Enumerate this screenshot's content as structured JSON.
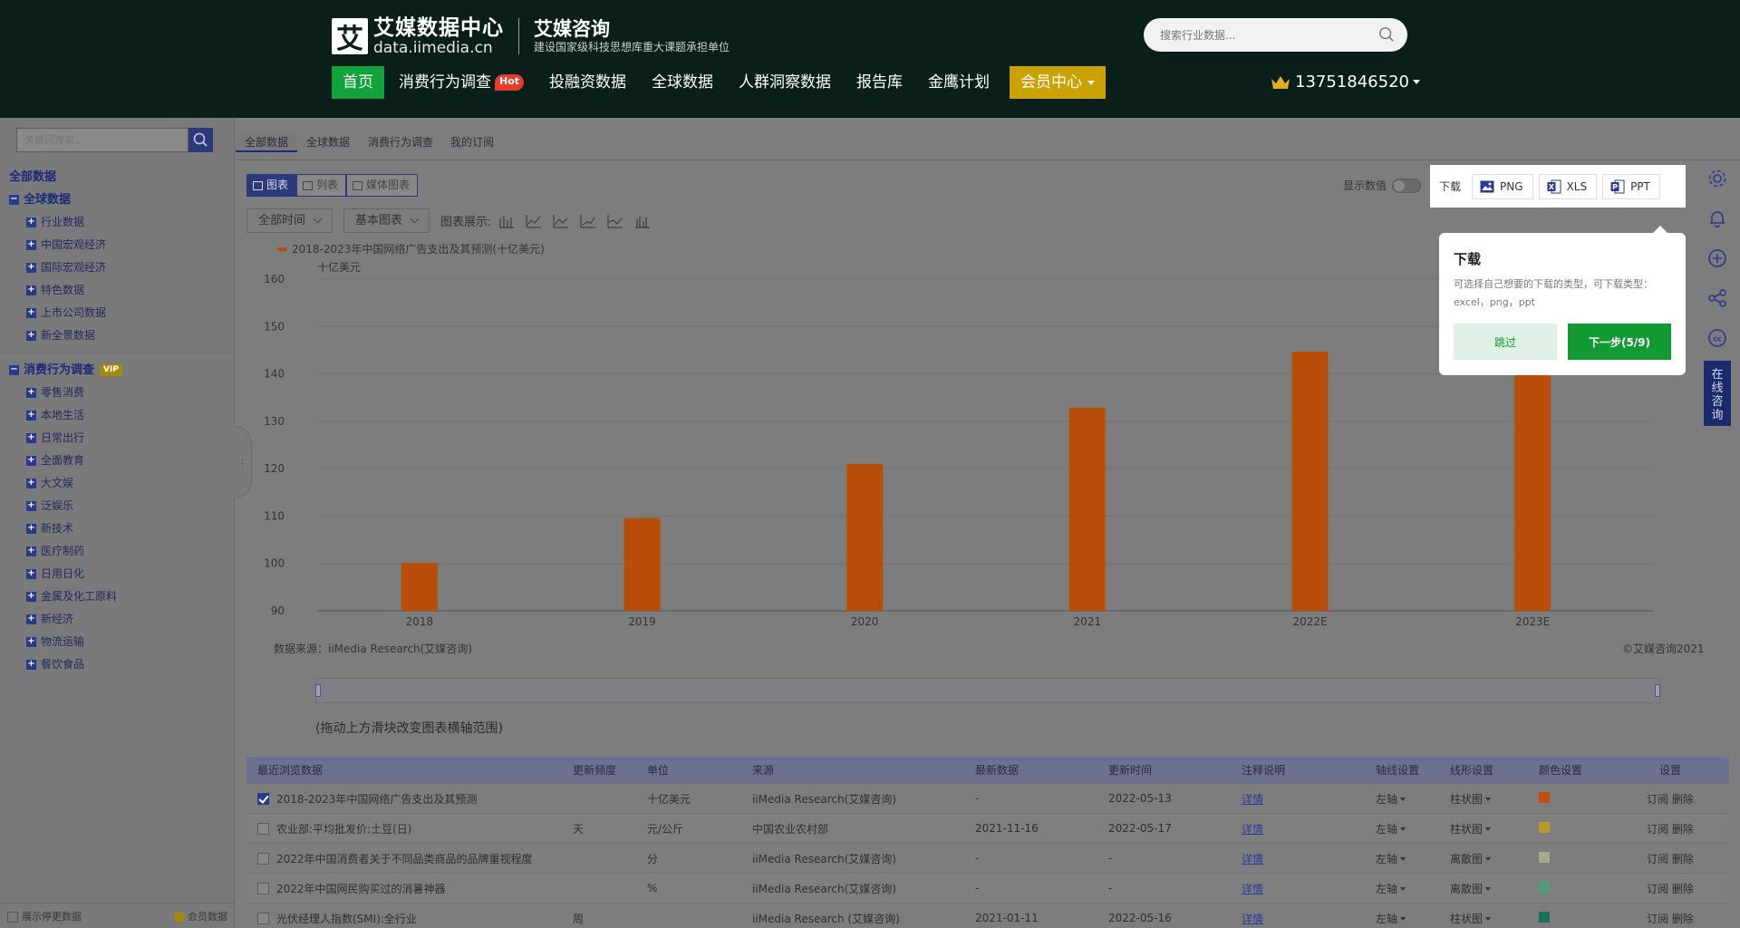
{
  "header": {
    "logo_mark": "艾",
    "logo_title": "艾媒数据中心",
    "logo_domain": "data.iimedia.cn",
    "brand_title": "艾媒咨询",
    "brand_subtitle": "建设国家级科技思想库重大课题承担单位",
    "search_placeholder": "搜索行业数据...",
    "nav": [
      {
        "label": "首页"
      },
      {
        "label": "消费行为调查",
        "badge": "Hot"
      },
      {
        "label": "投融资数据"
      },
      {
        "label": "全球数据"
      },
      {
        "label": "人群洞察数据"
      },
      {
        "label": "报告库"
      },
      {
        "label": "金鹰计划"
      },
      {
        "label": "会员中心"
      }
    ],
    "user_phone": "13751846520"
  },
  "sidebar": {
    "search_placeholder": "关键词搜索...",
    "root": "全部数据",
    "groups": [
      {
        "label": "全球数据",
        "items": [
          "行业数据",
          "中国宏观经济",
          "国际宏观经济",
          "特色数据",
          "上市公司数据",
          "新全景数据"
        ]
      },
      {
        "label": "消费行为调查",
        "tag": "VIP",
        "items": [
          "零售消费",
          "本地生活",
          "日常出行",
          "全面教育",
          "大文娱",
          "泛娱乐",
          "新技术",
          "医疗制药",
          "日用日化",
          "金属及化工原料",
          "新经济",
          "物流运输",
          "餐饮食品"
        ]
      }
    ],
    "bottom_left": "展示停更数据",
    "bottom_right": "会员数据"
  },
  "subtabs": [
    "全部数据",
    "全球数据",
    "消费行为调查",
    "我的订阅"
  ],
  "view_toggle": [
    "图表",
    "列表",
    "媒体图表"
  ],
  "controls": {
    "time_select": "全部时间",
    "chart_select": "基本图表",
    "chart_display_label": "图表展示:",
    "show_data_label": "显示数值"
  },
  "download": {
    "label": "下载",
    "buttons": [
      "PNG",
      "XLS",
      "PPT"
    ]
  },
  "tooltip": {
    "title": "下载",
    "body": "可选择自己想要的下载的类型，可下载类型：excel，png，ppt",
    "skip": "跳过",
    "next": "下一步(5/9)"
  },
  "consult_label": "在线咨询",
  "chart_data": {
    "type": "bar",
    "title": "",
    "legend": [
      "2018-2023年中国网络广告支出及其预测(十亿美元)"
    ],
    "unit_label": "十亿美元",
    "categories": [
      "2018",
      "2019",
      "2020",
      "2021",
      "2022E",
      "2023E"
    ],
    "series": [
      {
        "name": "2018-2023年中国网络广告支出及其预测(十亿美元)",
        "values": [
          100.1,
          109.6,
          121.0,
          132.9,
          144.7,
          155.3
        ],
        "color": "#b84e0a"
      }
    ],
    "ylim": [
      90,
      160
    ],
    "yticks": [
      90,
      100,
      110,
      120,
      130,
      140,
      150,
      160
    ],
    "grid": true,
    "source": "数据来源：iiMedia Research(艾媒咨询)",
    "copyright": "©艾媒咨询2021"
  },
  "range_hint": "(拖动上方滑块改变图表横轴范围)",
  "table": {
    "headers": [
      "最近浏览数据",
      "更新频度",
      "单位",
      "来源",
      "最新数据",
      "更新时间",
      "注释说明",
      "轴线设置",
      "线形设置",
      "颜色设置",
      "设置"
    ],
    "rows": [
      {
        "name": "2018-2023年中国网络广告支出及其预测",
        "freq": "",
        "unit": "十亿美元",
        "source": "iiMedia Research(艾媒咨询)",
        "latest": "-",
        "updated": "2022-05-13",
        "note": "详情",
        "axis": "左轴",
        "line": "柱状图",
        "color": "#c24d12",
        "actions": "订阅 删除",
        "checked": true
      },
      {
        "name": "农业部:平均批发价:土豆(日)",
        "freq": "天",
        "unit": "元/公斤",
        "source": "中国农业农村部",
        "latest": "2021-11-16",
        "updated": "2022-05-17",
        "note": "详情",
        "axis": "左轴",
        "line": "柱状图",
        "color": "#b89a2a",
        "actions": "订阅 删除",
        "checked": false
      },
      {
        "name": "2022年中国消费者关于不同品类商品的品牌重视程度",
        "freq": "",
        "unit": "分",
        "source": "iiMedia Research(艾媒咨询)",
        "latest": "-",
        "updated": "-",
        "note": "详情",
        "axis": "左轴",
        "line": "离散图",
        "color": "#a8a88a",
        "actions": "订阅 删除",
        "checked": false
      },
      {
        "name": "2022年中国网民购买过的消暑神器",
        "freq": "",
        "unit": "%",
        "source": "iiMedia Research(艾媒咨询)",
        "latest": "-",
        "updated": "-",
        "note": "详情",
        "axis": "左轴",
        "line": "离散图",
        "color": "#4e9e7a",
        "actions": "订阅 删除",
        "checked": false
      },
      {
        "name": "光伏经理人指数(SMI):全行业",
        "freq": "周",
        "unit": "",
        "source": "iiMedia Research (艾媒咨询)",
        "latest": "2021-01-11",
        "updated": "2022-05-16",
        "note": "详情",
        "axis": "左轴",
        "line": "柱状图",
        "color": "#1e6e5a",
        "actions": "订阅 删除",
        "checked": false
      }
    ]
  }
}
